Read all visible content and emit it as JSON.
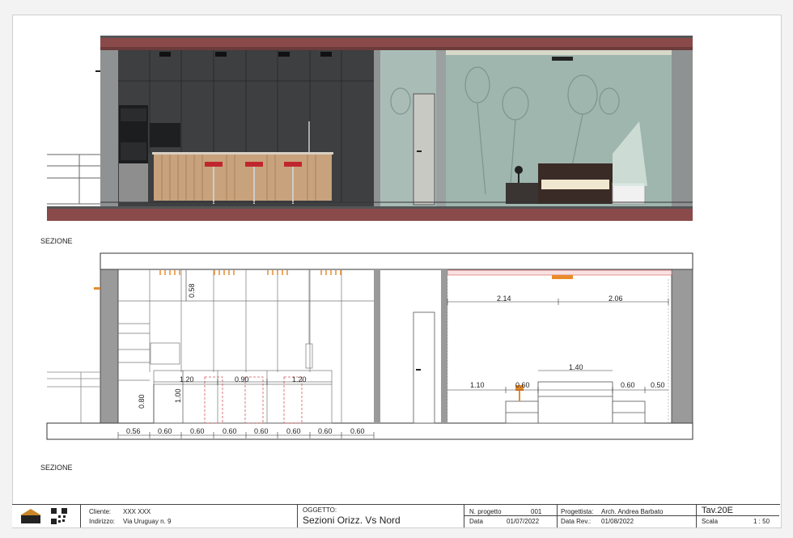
{
  "section_top_label": "SEZIONE",
  "section_bottom_label": "SEZIONE",
  "dims": {
    "h_058": "0.58",
    "w_214": "2.14",
    "w_206": "2.06",
    "w_140": "1.40",
    "w_110": "1.10",
    "w_060a": "0.60",
    "w_060b": "0.60",
    "w_050": "0.50",
    "w_120a": "1.20",
    "w_090": "0.90",
    "w_120b": "1.20",
    "h_100": "1.00",
    "h_080": "0.80",
    "base": [
      "0.56",
      "0.60",
      "0.60",
      "0.60",
      "0.60",
      "0.60",
      "0.60",
      "0.60"
    ]
  },
  "title_block": {
    "cliente_label": "Cliente:",
    "cliente_value": "XXX XXX",
    "indirizzo_label": "Indirizzo:",
    "indirizzo_value": "Via Uruguay n. 9",
    "oggetto_label": "OGGETTO:",
    "oggetto_value": "Sezioni Orizz. Vs Nord",
    "nprogetto_label": "N. progetto",
    "nprogetto_value": "001",
    "data_label": "Data",
    "data_value": "01/07/2022",
    "progettista_label": "Progettista:",
    "progettista_value": "Arch. Andrea Barbato",
    "datarev_label": "Data Rev.:",
    "datarev_value": "01/08/2022",
    "tav": "Tav.20E",
    "scala_label": "Scala",
    "scala_value": "1 : 50"
  },
  "colors": {
    "brick": "#8b4a4a",
    "wall_grey": "#8f9292",
    "cabinet": "#3d3f41",
    "glass": "#a9bdb6",
    "wood": "#c8a27c",
    "accent_orange": "#e98b2a"
  }
}
